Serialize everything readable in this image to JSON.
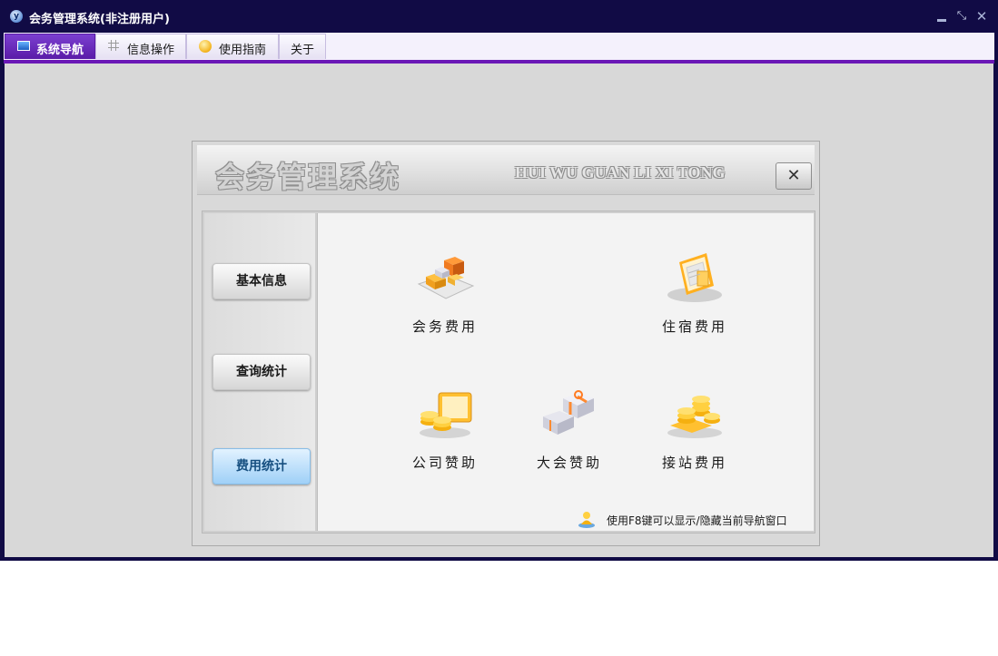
{
  "window": {
    "title": "会务管理系统(非注册用户)",
    "logo_letter": "y",
    "controls": {
      "minimize": "",
      "restore": "⤡",
      "close": "✕"
    }
  },
  "menu": {
    "tabs": [
      {
        "label": "系统导航",
        "icon": "monitor-icon",
        "active": true
      },
      {
        "label": "信息操作",
        "icon": "grid-icon",
        "active": false
      },
      {
        "label": "使用指南",
        "icon": "guide-icon",
        "active": false
      },
      {
        "label": "关于",
        "icon": "",
        "active": false
      }
    ]
  },
  "dialog": {
    "title_cn": "会务管理系统",
    "title_en": "HUI WU GUAN LI XI TONG",
    "close_label": "✕",
    "sidebar": [
      {
        "label": "基本信息",
        "active": false
      },
      {
        "label": "查询统计",
        "active": false
      },
      {
        "label": "费用统计",
        "active": true
      }
    ],
    "items": [
      {
        "label": "会务费用",
        "icon": "boxes-icon"
      },
      {
        "label": "住宿费用",
        "icon": "document-icon"
      },
      {
        "label": "公司赞助",
        "icon": "coins-card-icon"
      },
      {
        "label": "大会赞助",
        "icon": "gift-icon"
      },
      {
        "label": "接站费用",
        "icon": "coin-stack-icon"
      }
    ],
    "hint": "使用F8键可以显示/隐藏当前导航窗口"
  },
  "colors": {
    "titlebar": "#110b45",
    "menu_accent": "#6a18b6",
    "workspace": "#d8d8d8",
    "active_side_button": "#9fd0f7"
  }
}
